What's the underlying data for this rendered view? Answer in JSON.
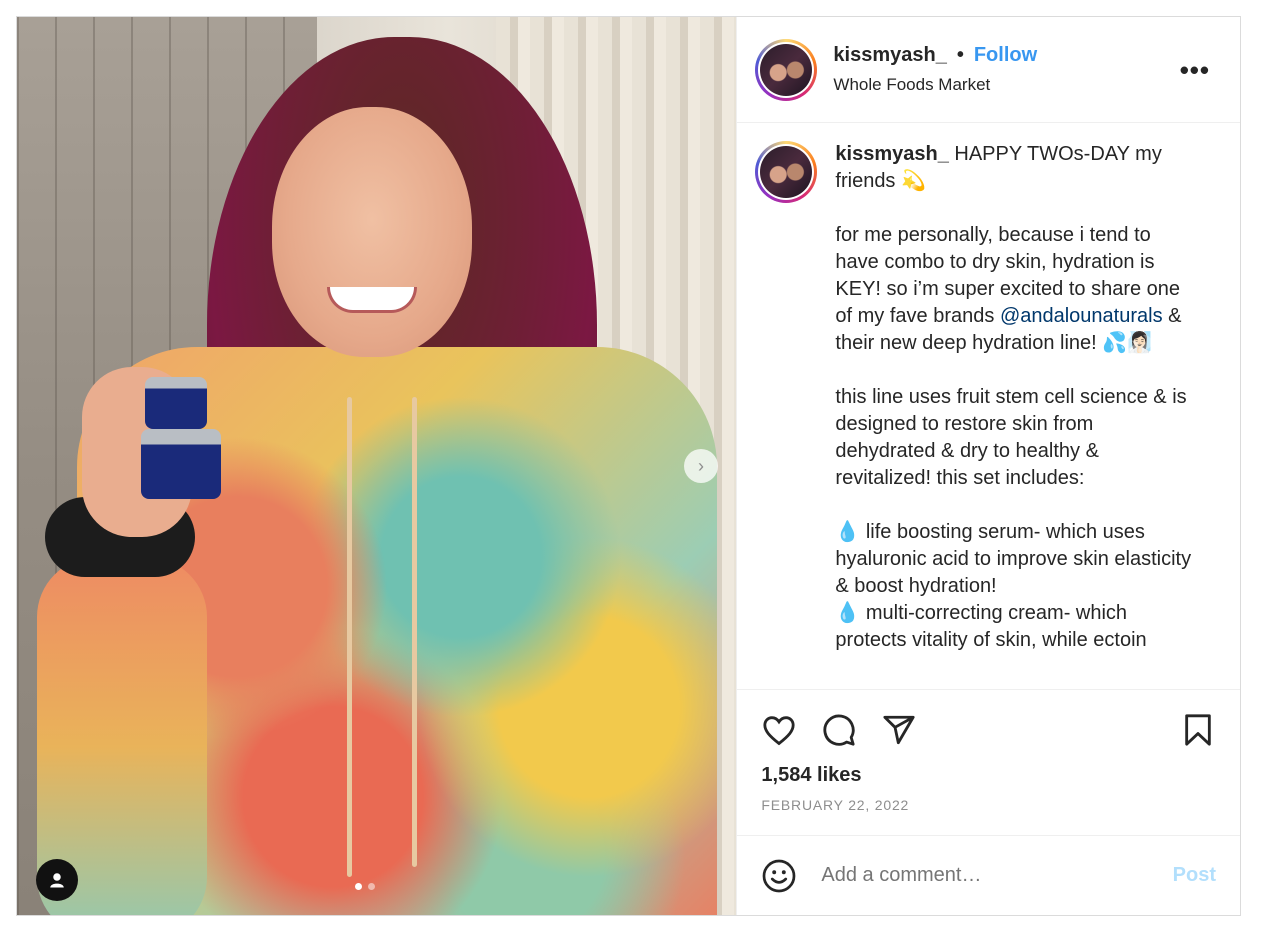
{
  "header": {
    "username": "kissmyash_",
    "separator": "•",
    "follow_label": "Follow",
    "location": "Whole Foods Market",
    "more_label": "•••"
  },
  "caption": {
    "username": "kissmyash_",
    "paragraphs": [
      "HAPPY TWOs-DAY my friends 💫",
      "for me personally, because i tend to have combo to dry skin, hydration is KEY! so i’m super excited to share one of my fave brands",
      "this line uses fruit stem cell science & is designed to restore skin from dehydrated & dry to healthy & revitalized! this set includes:",
      "💧 life boosting serum- which uses hyaluronic acid to improve skin elasticity & boost hydration!\n💧 multi-correcting cream- which protects vitality of skin, while ectoin"
    ],
    "mention": "@andalounaturals",
    "after_mention": " & their new deep hydration line! 💦🧖🏻‍♀️"
  },
  "engagement": {
    "likes": "1,584 likes",
    "date": "FEBRUARY 22, 2022"
  },
  "comment_box": {
    "placeholder": "Add a comment…",
    "post_label": "Post"
  },
  "media": {
    "next_arrow": "›",
    "slide_count": 2,
    "active_slide": 1
  },
  "colors": {
    "follow": "#3897f0",
    "post_disabled": "#b2dffc",
    "mention": "#00376b",
    "border": "#dbdbdb"
  }
}
